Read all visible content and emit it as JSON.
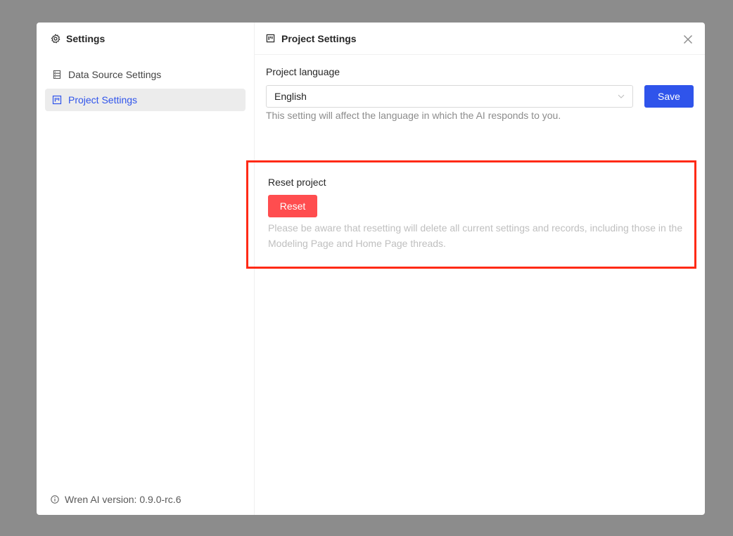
{
  "sidebar": {
    "title": "Settings",
    "title_icon": "gear-icon",
    "items": [
      {
        "label": "Data Source Settings",
        "icon": "database-icon",
        "active": false
      },
      {
        "label": "Project Settings",
        "icon": "project-icon",
        "active": true
      }
    ],
    "version": "Wren AI version: 0.9.0-rc.6"
  },
  "main": {
    "title": "Project Settings",
    "language": {
      "label": "Project language",
      "value": "English",
      "save_label": "Save",
      "help": "This setting will affect the language in which the AI responds to you."
    },
    "reset": {
      "label": "Reset project",
      "button_label": "Reset",
      "warning": "Please be aware that resetting will delete all current settings and records, including those in the Modeling Page and Home Page threads."
    }
  },
  "colors": {
    "accent": "#2f54eb",
    "danger": "#ff4d4f",
    "highlight_border": "#ff2a16",
    "overlay": "#8c8c8c"
  }
}
